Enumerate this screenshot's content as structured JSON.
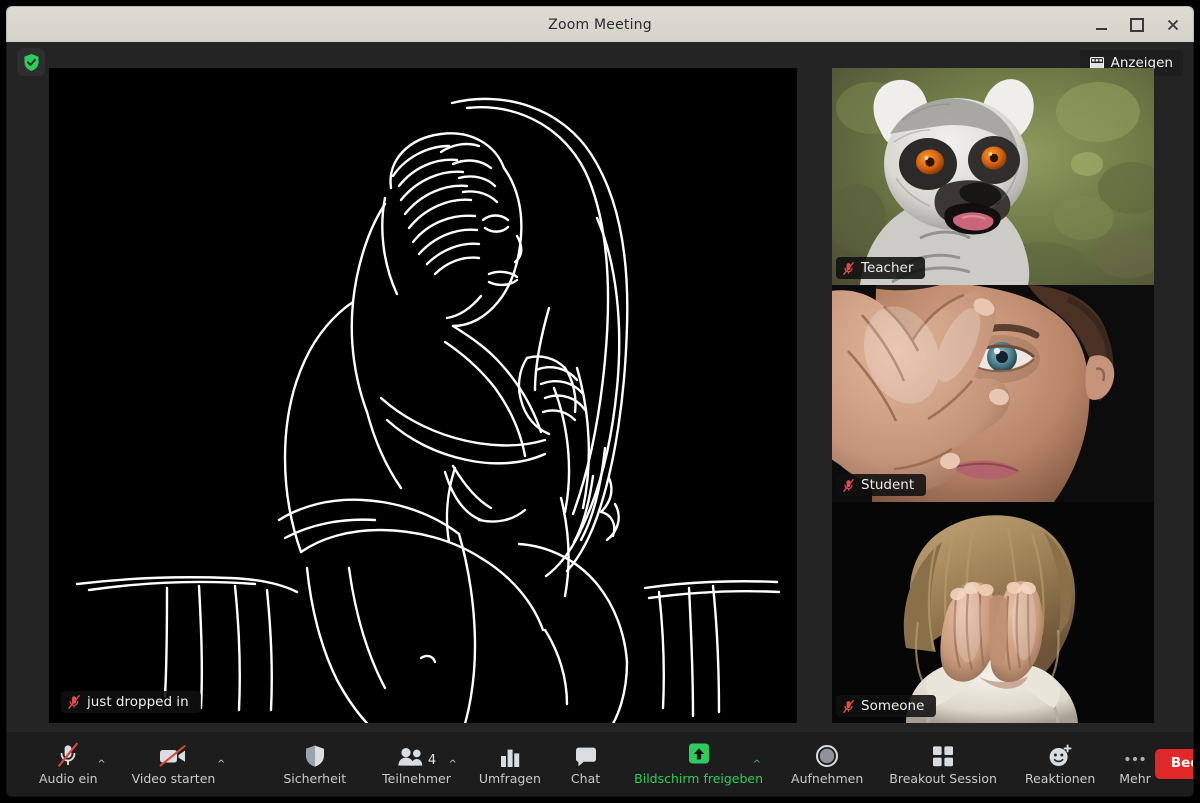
{
  "window": {
    "title": "Zoom Meeting",
    "controls": [
      {
        "name": "minimize",
        "glyph": "–"
      },
      {
        "name": "maximize",
        "glyph": "□"
      },
      {
        "name": "close",
        "glyph": "×"
      }
    ]
  },
  "header": {
    "security_icon": "shield-check-icon",
    "view_button": {
      "label": "Anzeigen",
      "icon": "view-grid-icon"
    }
  },
  "main_video": {
    "nameplate": "just dropped in",
    "mic_status": "muted",
    "content_description": "white line drawing of two embracing figures on black background"
  },
  "thumbnails": [
    {
      "nameplate": "Teacher",
      "mic_status": "muted",
      "content_description": "ring-tailed lemur with open mouth, blurred green foliage background"
    },
    {
      "nameplate": "Student",
      "mic_status": "muted",
      "content_description": "child covering face with one hand, one blue eye visible, dark background"
    },
    {
      "nameplate": "Someone",
      "mic_status": "muted",
      "content_description": "blond child covering face with both hands, white shirt, black background"
    }
  ],
  "toolbar": {
    "items": [
      {
        "label": "Audio ein",
        "icon": "microphone-muted-icon",
        "caret": true,
        "accent": "default"
      },
      {
        "label": "Video starten",
        "icon": "video-muted-icon",
        "caret": true,
        "accent": "default"
      },
      {
        "label": "Sicherheit",
        "icon": "shield-icon",
        "caret": false,
        "accent": "default"
      },
      {
        "label": "Teilnehmer",
        "icon": "participants-icon",
        "caret": true,
        "accent": "default",
        "count": "4"
      },
      {
        "label": "Umfragen",
        "icon": "poll-bars-icon",
        "caret": false,
        "accent": "default"
      },
      {
        "label": "Chat",
        "icon": "chat-bubble-icon",
        "caret": false,
        "accent": "default"
      },
      {
        "label": "Bildschirm freigeben",
        "icon": "share-screen-icon",
        "caret": true,
        "accent": "green"
      },
      {
        "label": "Aufnehmen",
        "icon": "record-circle-icon",
        "caret": false,
        "accent": "default"
      },
      {
        "label": "Breakout Session",
        "icon": "breakout-rooms-icon",
        "caret": false,
        "accent": "default"
      },
      {
        "label": "Reaktionen",
        "icon": "reactions-smiley-icon",
        "caret": false,
        "accent": "default"
      },
      {
        "label": "Mehr",
        "icon": "more-dots-icon",
        "caret": false,
        "accent": "default"
      }
    ],
    "end_button": {
      "label": "Beenden",
      "color": "#e02828"
    }
  },
  "colors": {
    "app_background": "#242424",
    "toolbar_background": "#1d1d1d",
    "titlebar_background": "#d6d3cd",
    "accent_green": "#2ecc5f",
    "end_red": "#e02828",
    "mute_red": "#e04b4b"
  }
}
